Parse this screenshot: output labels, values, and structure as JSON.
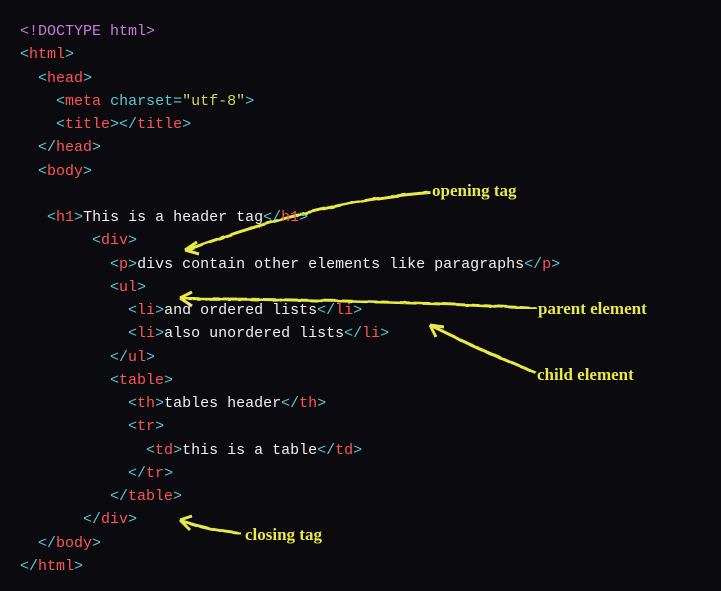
{
  "code": {
    "doctype": "<!DOCTYPE html>",
    "html": "html",
    "head": "head",
    "meta": "meta",
    "charset_attr": "charset",
    "charset_val": "\"utf-8\"",
    "title": "title",
    "body": "body",
    "h1": "h1",
    "h1_text": "This is a header tag",
    "div": "div",
    "p": "p",
    "p_text": "divs contain other elements like paragraphs",
    "ul": "ul",
    "li": "li",
    "li1_text": "and ordered lists",
    "li2_text": "also unordered lists",
    "table": "table",
    "th": "th",
    "th_text": "tables header",
    "tr": "tr",
    "td": "td",
    "td_text": "this is a table"
  },
  "annotations": {
    "opening_tag": "opening tag",
    "parent_element": "parent element",
    "child_element": "child element",
    "closing_tag": "closing tag"
  }
}
